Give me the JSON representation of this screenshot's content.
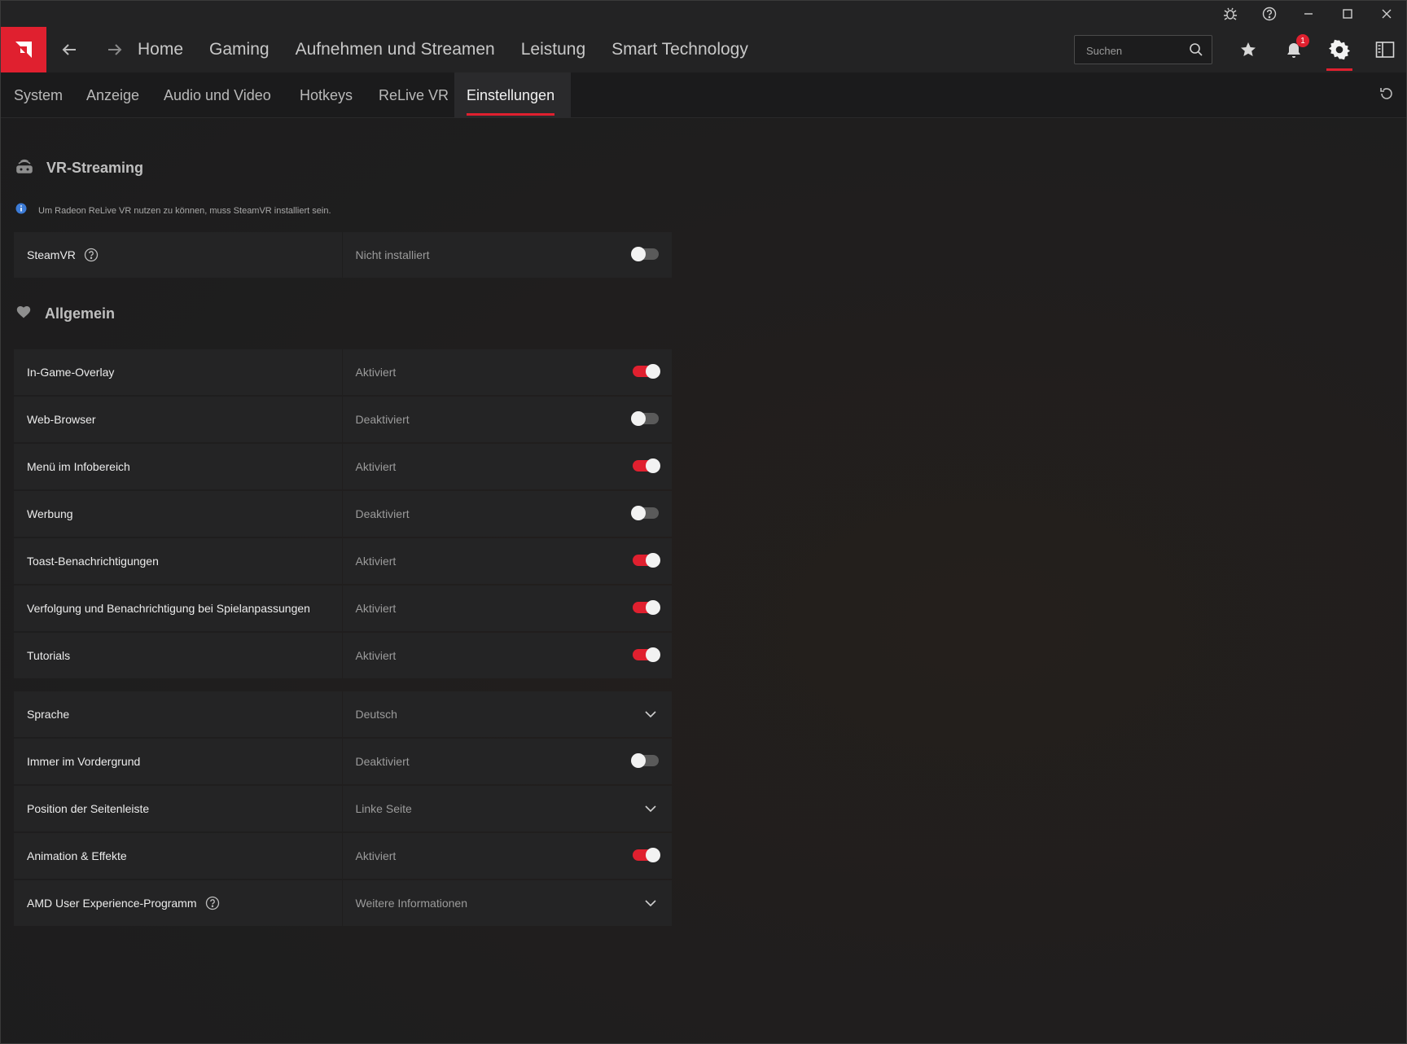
{
  "titlebar": {
    "icons": [
      "bug-icon",
      "help-icon",
      "minimize-icon",
      "maximize-icon",
      "close-icon"
    ]
  },
  "header": {
    "nav": [
      "Home",
      "Gaming",
      "Aufnehmen und Streamen",
      "Leistung",
      "Smart Technology"
    ],
    "search_placeholder": "Suchen",
    "notification_count": "1",
    "accent": "#e0202f"
  },
  "subnav": {
    "tabs": [
      "System",
      "Anzeige",
      "Audio und Video",
      "Hotkeys",
      "ReLive VR",
      "Einstellungen"
    ],
    "active": "Einstellungen"
  },
  "vr": {
    "title": "VR-Streaming",
    "info": "Um Radeon ReLive VR nutzen zu können, muss SteamVR installiert sein.",
    "steamvr_label": "SteamVR",
    "steamvr_value": "Nicht installiert",
    "steamvr_on": false
  },
  "general": {
    "title": "Allgemein",
    "rows": [
      {
        "label": "In-Game-Overlay",
        "value": "Aktiviert",
        "on": true
      },
      {
        "label": "Web-Browser",
        "value": "Deaktiviert",
        "on": false
      },
      {
        "label": "Menü im Infobereich",
        "value": "Aktiviert",
        "on": true
      },
      {
        "label": "Werbung",
        "value": "Deaktiviert",
        "on": false
      },
      {
        "label": "Toast-Benachrichtigungen",
        "value": "Aktiviert",
        "on": true
      },
      {
        "label": "Verfolgung und Benachrichtigung bei Spielanpassungen",
        "value": "Aktiviert",
        "on": true
      },
      {
        "label": "Tutorials",
        "value": "Aktiviert",
        "on": true
      }
    ]
  },
  "other": {
    "rows": [
      {
        "label": "Sprache",
        "value": "Deutsch"
      },
      {
        "label": "Immer im Vordergrund",
        "value": "Deaktiviert",
        "on": false
      },
      {
        "label": "Position der Seitenleiste",
        "value": "Linke Seite"
      },
      {
        "label": "Animation & Effekte",
        "value": "Aktiviert",
        "on": true
      },
      {
        "label": "AMD User Experience-Programm",
        "value": "Weitere Informationen"
      }
    ]
  }
}
